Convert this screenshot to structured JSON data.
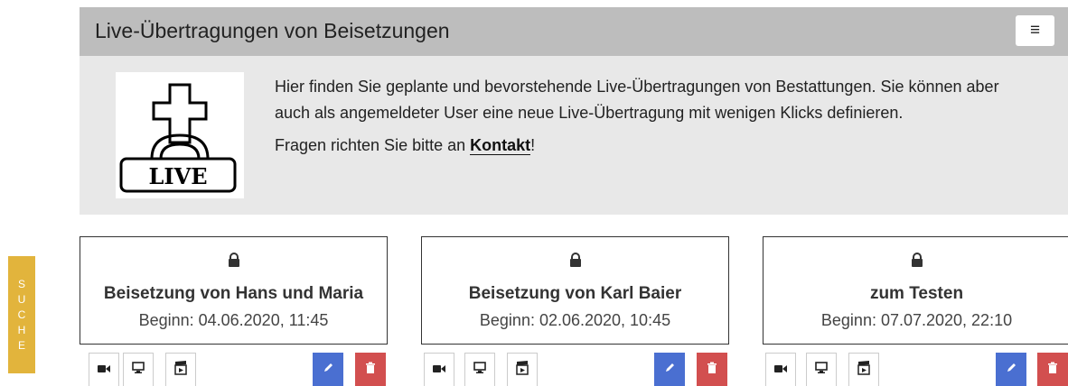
{
  "header": {
    "title": "Live-Übertragungen von Beisetzungen",
    "menu_icon": "hamburger-icon"
  },
  "intro": {
    "logo_text": "LIVE",
    "text": "Hier finden Sie geplante und bevorstehende Live-Übertragungen von Bestattungen. Sie können aber auch als angemeldeter User eine neue Live-Übertragung mit wenigen Klicks definieren.",
    "contact_prefix": "Fragen richten Sie bitte an ",
    "contact_link": "Kontakt",
    "contact_suffix": "!"
  },
  "side_tab": {
    "letters": [
      "S",
      "U",
      "C",
      "H",
      "E"
    ]
  },
  "cards": [
    {
      "title": "Beisetzung von Hans und Maria",
      "begin": "Beginn: 04.06.2020, 11:45"
    },
    {
      "title": "Beisetzung von Karl Baier",
      "begin": "Beginn: 02.06.2020, 10:45"
    },
    {
      "title": "zum Testen",
      "begin": "Beginn: 07.07.2020, 22:10"
    }
  ],
  "colors": {
    "header_bg": "#bdbdbd",
    "panel_bg": "#e8e8e8",
    "side_tab": "#e2b43c",
    "edit": "#4a6fd1",
    "delete": "#d24f4f"
  }
}
